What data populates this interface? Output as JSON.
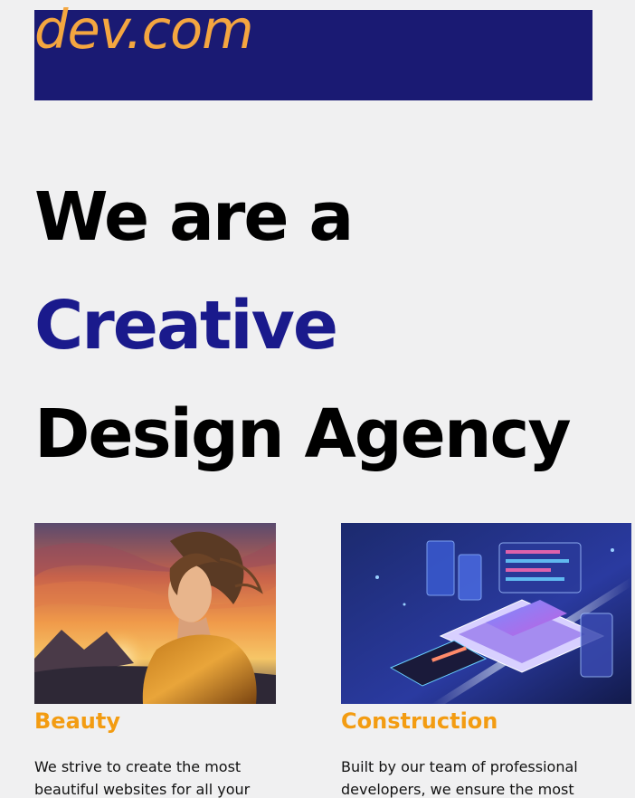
{
  "header": {
    "logo_text": "dev.com",
    "background_color": "#1a1a73",
    "logo_color": "#f4a640"
  },
  "hero": {
    "line1": "We are a",
    "line2": "Creative",
    "line3": "Design Agency",
    "accent_color": "#1a1a8c"
  },
  "cards": [
    {
      "title": "Beauty",
      "text": "We strive to create the most beautiful websites for all your",
      "image": "portrait-sunset-image"
    },
    {
      "title": "Construction",
      "text": "Built by our team of professional developers, we ensure the most",
      "image": "isometric-laptop-image"
    }
  ],
  "colors": {
    "page_background": "#f0f0f1",
    "card_title": "#f39c12"
  }
}
